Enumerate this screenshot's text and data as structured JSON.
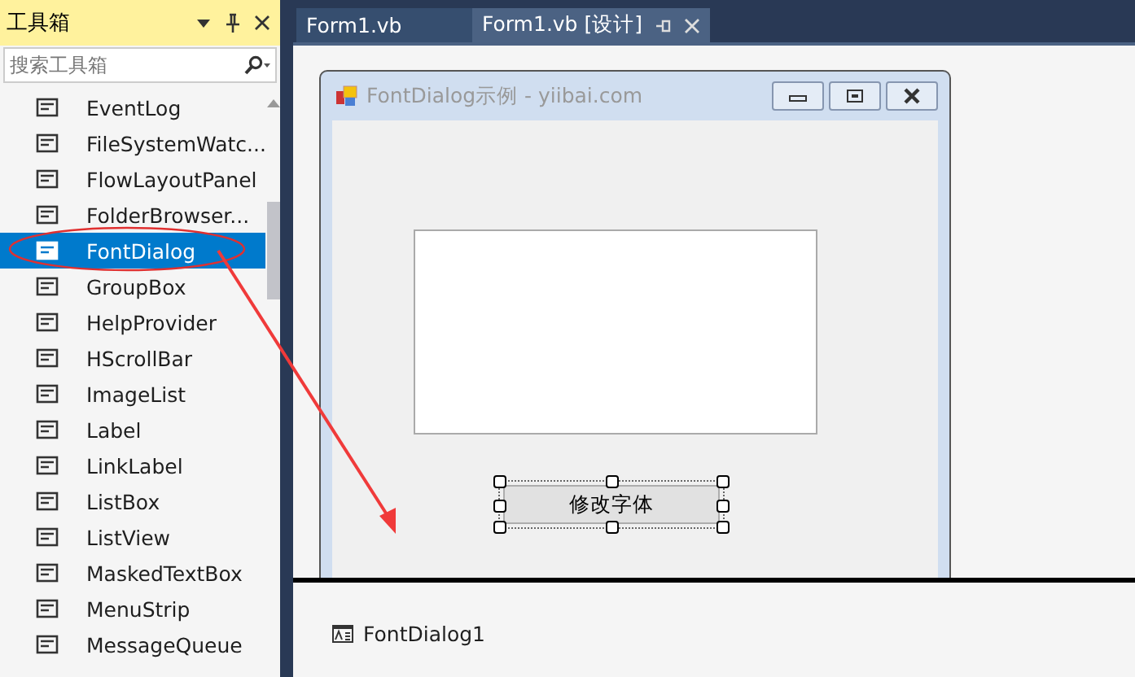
{
  "toolbox": {
    "title": "工具箱",
    "search": {
      "placeholder": "搜索工具箱"
    },
    "items": [
      {
        "label": "EventLog",
        "selected": false
      },
      {
        "label": "FileSystemWatc...",
        "selected": false
      },
      {
        "label": "FlowLayoutPanel",
        "selected": false
      },
      {
        "label": "FolderBrowser...",
        "selected": false
      },
      {
        "label": "FontDialog",
        "selected": true
      },
      {
        "label": "GroupBox",
        "selected": false
      },
      {
        "label": "HelpProvider",
        "selected": false
      },
      {
        "label": "HScrollBar",
        "selected": false
      },
      {
        "label": "ImageList",
        "selected": false
      },
      {
        "label": "Label",
        "selected": false
      },
      {
        "label": "LinkLabel",
        "selected": false
      },
      {
        "label": "ListBox",
        "selected": false
      },
      {
        "label": "ListView",
        "selected": false
      },
      {
        "label": "MaskedTextBox",
        "selected": false
      },
      {
        "label": "MenuStrip",
        "selected": false
      },
      {
        "label": "MessageQueue",
        "selected": false
      }
    ]
  },
  "tabs": [
    {
      "label": "Form1.vb",
      "selected": false
    },
    {
      "label": "Form1.vb [设计]",
      "selected": true
    }
  ],
  "form": {
    "title": "FontDialog示例 - yiibai.com",
    "button": "修改字体"
  },
  "tray": [
    {
      "label": "FontDialog1"
    }
  ]
}
